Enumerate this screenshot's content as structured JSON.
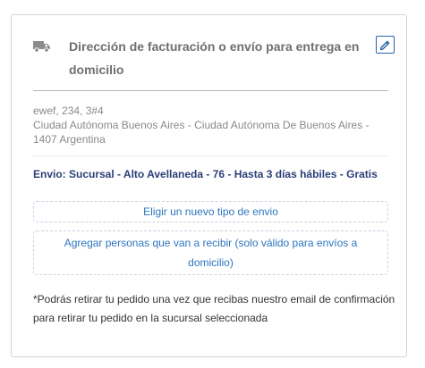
{
  "card": {
    "title": "Dirección de facturación o envío para entrega en domicilio",
    "icons": {
      "header": "truck-icon",
      "edit": "pencil-icon"
    },
    "address": {
      "line1": "ewef, 234, 3#4",
      "line2": "Ciudad Autónoma Buenos Aires - Ciudad Autónoma De Buenos Aires - 1407 Argentina"
    },
    "shipping_method": "Envio: Sucursal - Alto Avellaneda - 76 - Hasta 3 días hábiles - Gratis",
    "choose_shipping_label": "Eligir un nuevo tipo de envio",
    "add_recipients_label": "Agregar personas que van a recibir (solo válido para envíos a domicilio)",
    "pickup_note": "*Podrás retirar tu pedido una vez que recibas nuestro email de confirmación para retirar tu pedido en la sucursal seleccionada"
  },
  "colors": {
    "title": "#6f6f6f",
    "accent": "#2a63a8",
    "link": "#2c76c0",
    "shipping_text": "#2b3f77",
    "border": "#d3d3d3"
  }
}
